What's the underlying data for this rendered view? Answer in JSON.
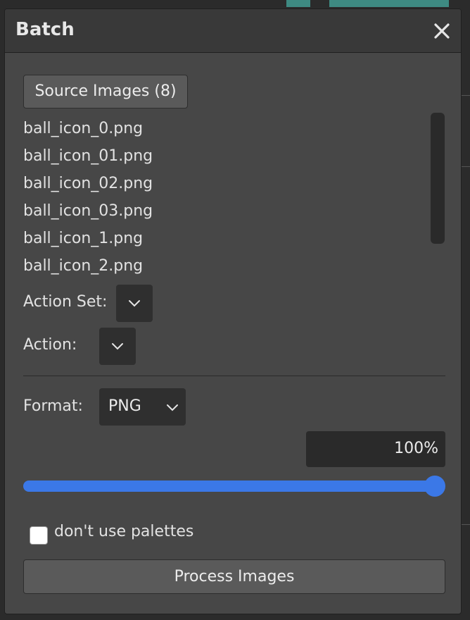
{
  "dialog": {
    "title": "Batch",
    "close_icon": "close-icon"
  },
  "source": {
    "button_label": "Source Images (8)",
    "files": [
      "ball_icon_0.png",
      "ball_icon_01.png",
      "ball_icon_02.png",
      "ball_icon_03.png",
      "ball_icon_1.png",
      "ball_icon_2.png"
    ]
  },
  "action_set": {
    "label": "Action Set:",
    "value": ""
  },
  "action": {
    "label": "Action:",
    "value": ""
  },
  "format": {
    "label": "Format:",
    "value": "PNG"
  },
  "quality": {
    "value_text": "100%",
    "value": 100
  },
  "palettes": {
    "label": "don't use palettes",
    "checked": false
  },
  "process": {
    "label": "Process Images"
  },
  "colors": {
    "dialog_bg": "#474747",
    "title_bg": "#393939",
    "accent": "#3b78e7",
    "button_bg": "#5a5a5a",
    "field_bg": "#2f2f2f"
  }
}
